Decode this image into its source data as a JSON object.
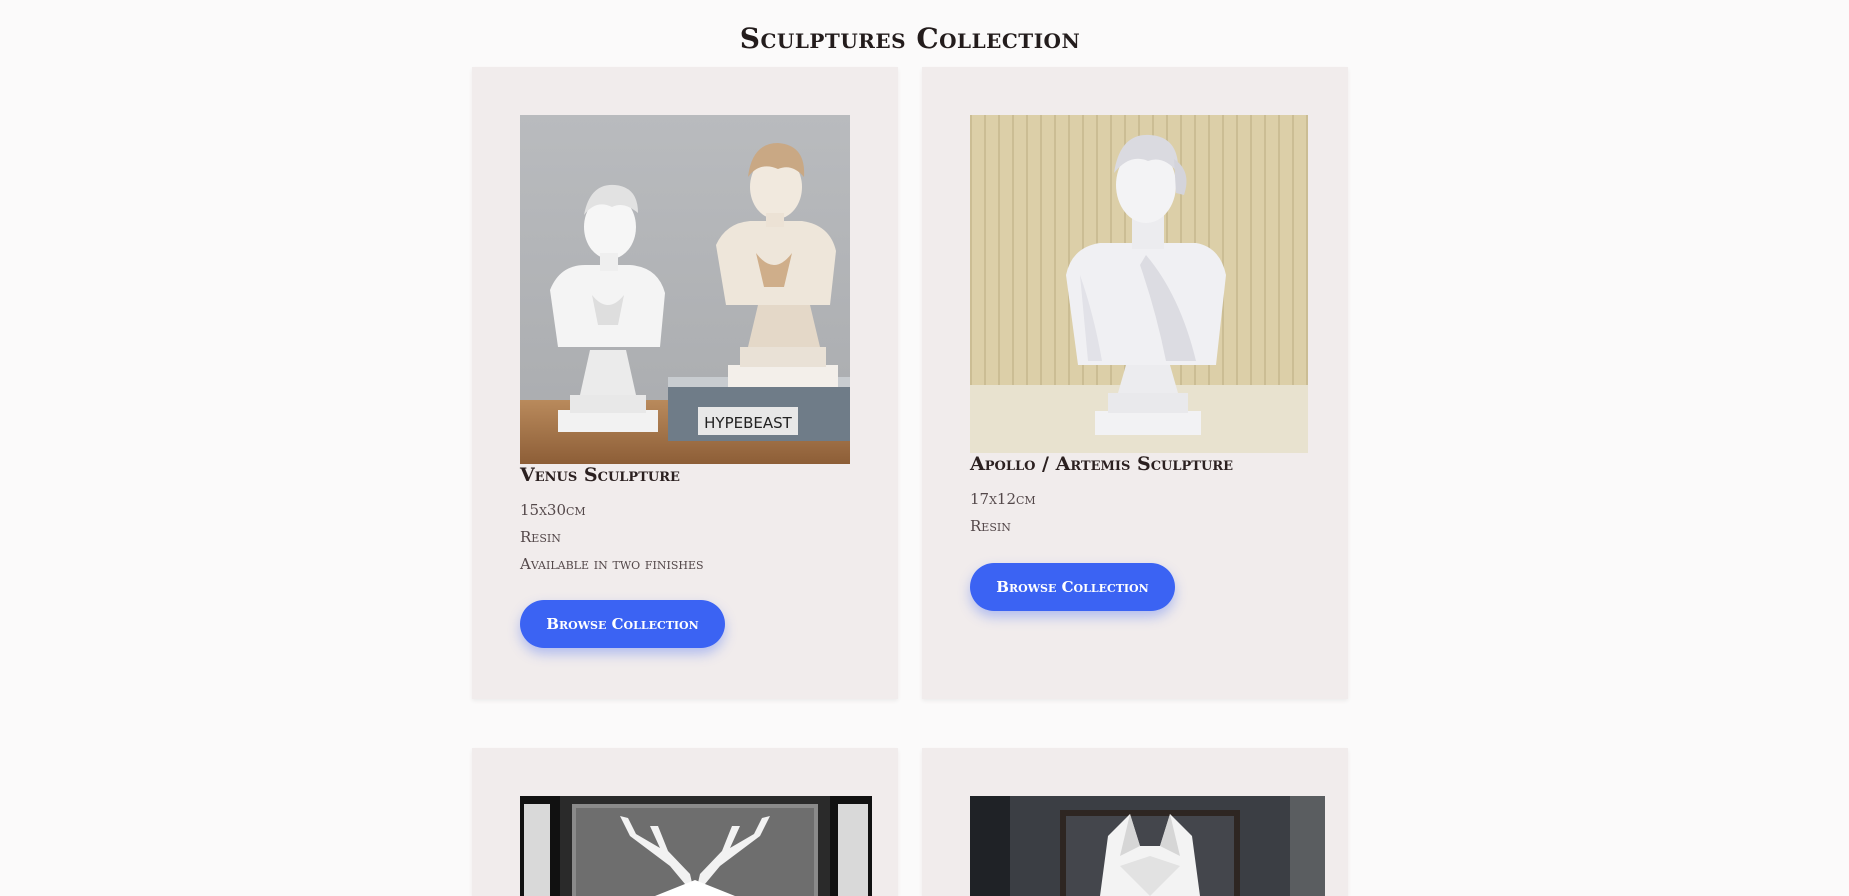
{
  "page": {
    "title": "Sculptures Collection"
  },
  "products": [
    {
      "title": "Venus Sculpture",
      "details": [
        "15x30cm",
        "Resin",
        "Available in two finishes"
      ],
      "button_label": "Browse Collection",
      "image_label": "HYPEBEAST"
    },
    {
      "title": "Apollo / Artemis Sculpture",
      "details": [
        "17x12cm",
        "Resin"
      ],
      "button_label": "Browse Collection"
    }
  ],
  "colors": {
    "background": "#fbfafa",
    "card": "#f1ecec",
    "button": "#3b63f3",
    "title": "#231c1c"
  }
}
